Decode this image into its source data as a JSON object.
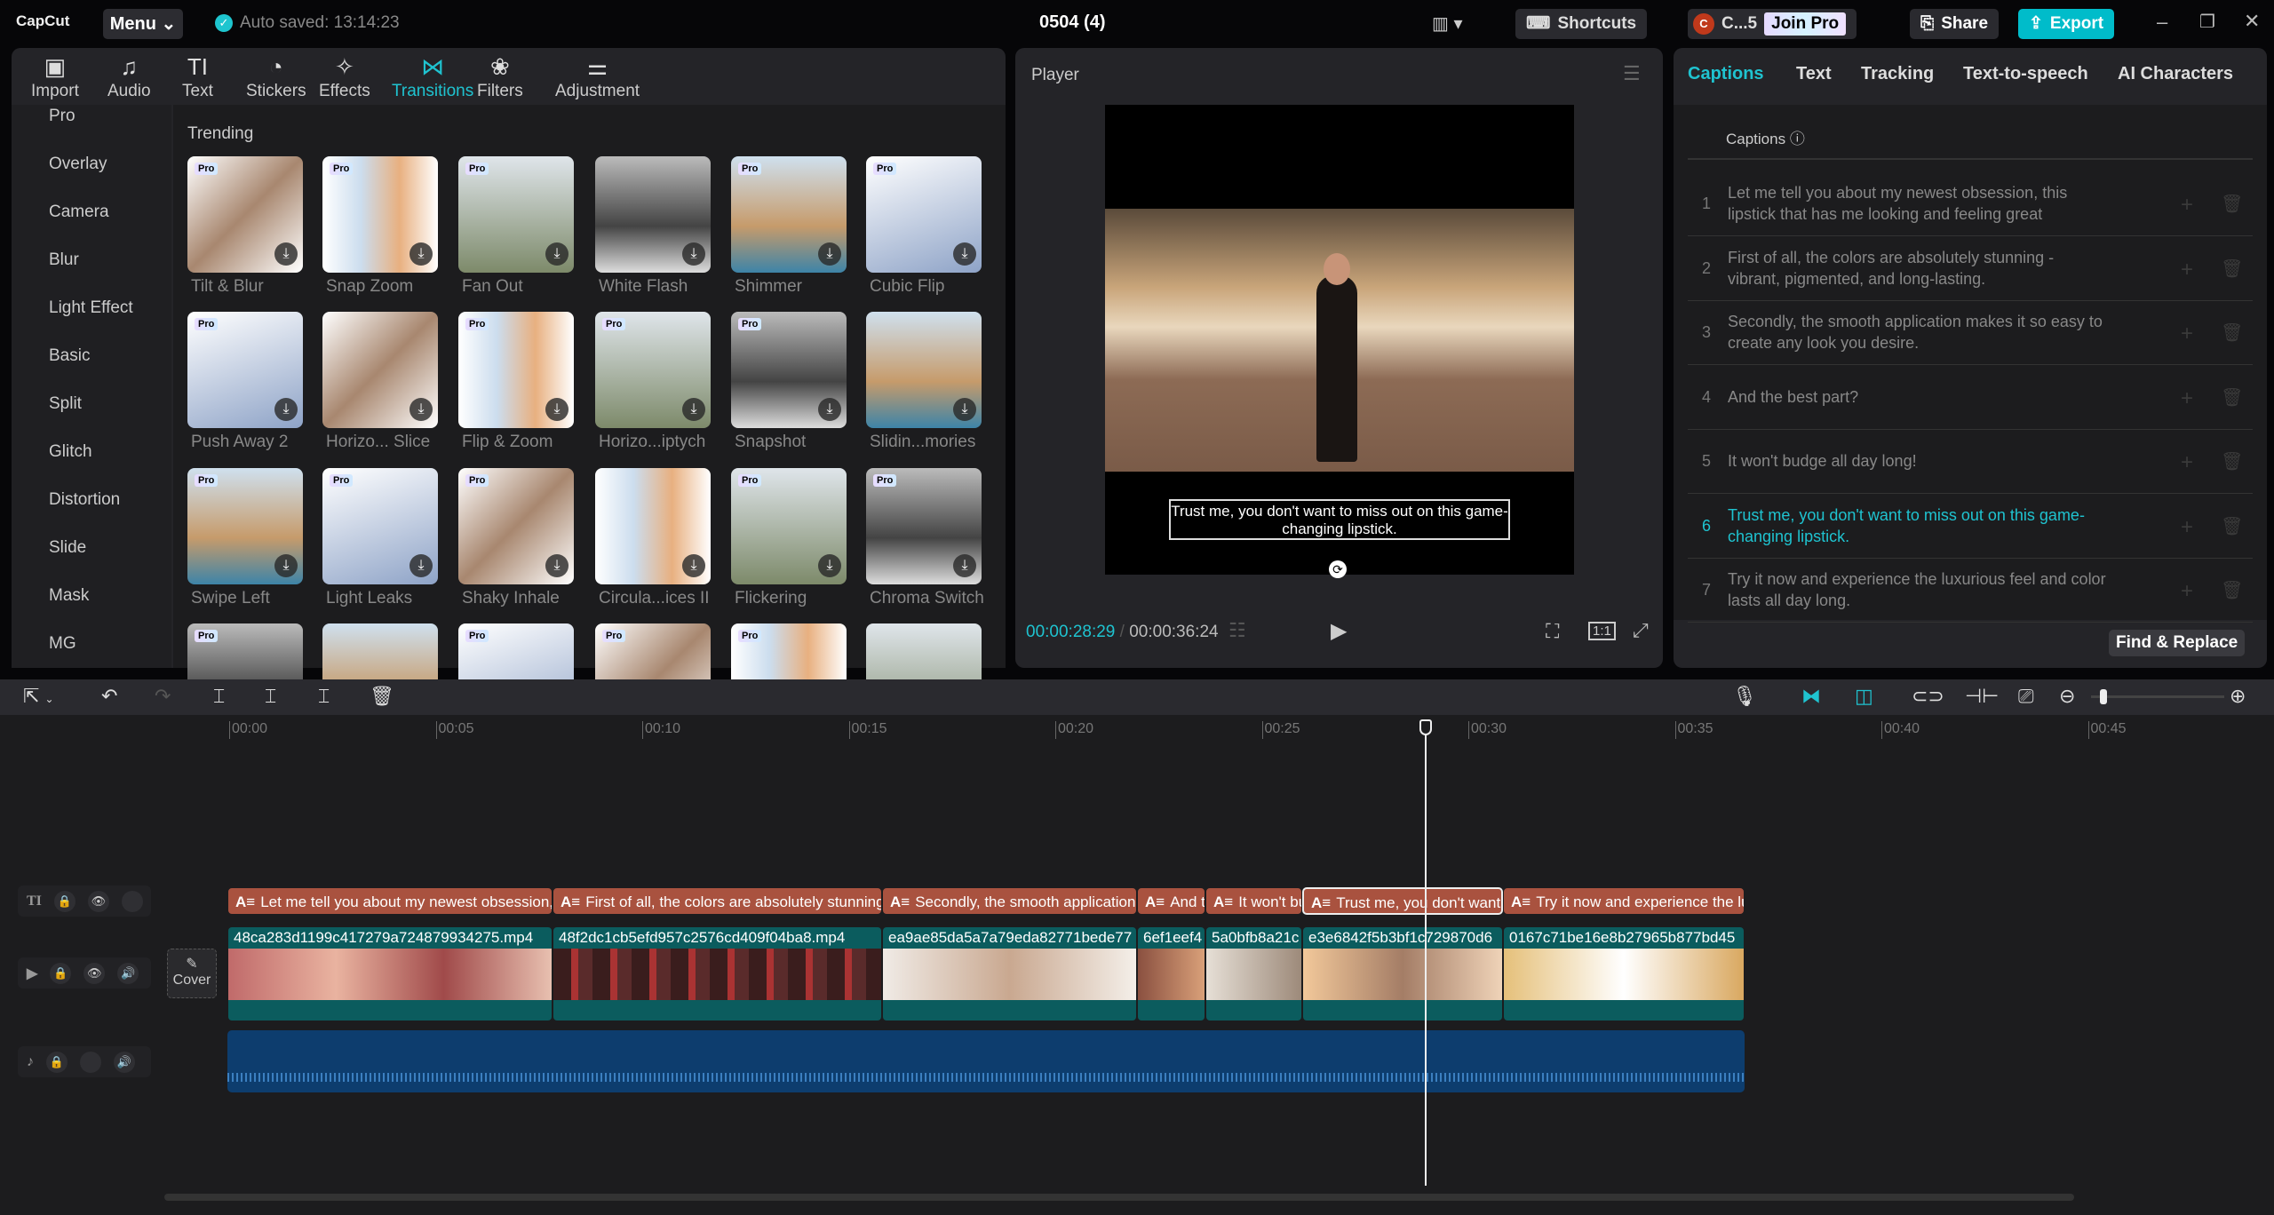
{
  "app": {
    "logo": "CapCut",
    "menu": "Menu",
    "autosave": "Auto saved: 13:14:23",
    "project_title": "0504 (4)",
    "shortcuts": "Shortcuts",
    "user": "C...5",
    "user_initial": "C",
    "join_pro": "Join Pro",
    "share": "Share",
    "export": "Export"
  },
  "toolbar": [
    {
      "label": "Import",
      "icon": "▣"
    },
    {
      "label": "Audio",
      "icon": "♫"
    },
    {
      "label": "Text",
      "icon": "TI"
    },
    {
      "label": "Stickers",
      "icon": "◔"
    },
    {
      "label": "Effects",
      "icon": "✧"
    },
    {
      "label": "Transitions",
      "icon": "⋈"
    },
    {
      "label": "Filters",
      "icon": "❀"
    },
    {
      "label": "Adjustment",
      "icon": "⚌"
    }
  ],
  "sidebar": [
    "Pro",
    "Overlay",
    "Camera",
    "Blur",
    "Light Effect",
    "Basic",
    "Split",
    "Glitch",
    "Distortion",
    "Slide",
    "Mask",
    "MG"
  ],
  "section_title": "Trending",
  "transitions": [
    {
      "name": "Tilt & Blur",
      "pro": true
    },
    {
      "name": "Snap Zoom",
      "pro": true
    },
    {
      "name": "Fan Out",
      "pro": true
    },
    {
      "name": "White Flash",
      "pro": false
    },
    {
      "name": "Shimmer",
      "pro": true
    },
    {
      "name": "Cubic Flip",
      "pro": true
    },
    {
      "name": "Push Away 2",
      "pro": true
    },
    {
      "name": "Horizo... Slice",
      "pro": false
    },
    {
      "name": "Flip & Zoom",
      "pro": true
    },
    {
      "name": "Horizo...iptych",
      "pro": true
    },
    {
      "name": "Snapshot",
      "pro": true
    },
    {
      "name": "Slidin...mories",
      "pro": false
    },
    {
      "name": "Swipe Left",
      "pro": true
    },
    {
      "name": "Light Leaks",
      "pro": true
    },
    {
      "name": "Shaky Inhale",
      "pro": true
    },
    {
      "name": "Circula...ices II",
      "pro": false
    },
    {
      "name": "Flickering",
      "pro": true
    },
    {
      "name": "Chroma Switch",
      "pro": true
    },
    {
      "name": "",
      "pro": true
    },
    {
      "name": "",
      "pro": false
    },
    {
      "name": "",
      "pro": true
    },
    {
      "name": "",
      "pro": true
    },
    {
      "name": "",
      "pro": true
    },
    {
      "name": "",
      "pro": false
    }
  ],
  "pro_badge": "Pro",
  "player": {
    "title": "Player",
    "caption": "Trust me, you don't want to miss out on this game-changing lipstick.",
    "current_time": "00:00:28:29",
    "total_time": "00:00:36:24",
    "ratio": "1:1"
  },
  "captions_panel": {
    "tabs": [
      "Captions",
      "Text",
      "Tracking",
      "Text-to-speech",
      "AI Characters"
    ],
    "active_tab": 0,
    "header": "Captions",
    "find_replace": "Find & Replace",
    "items": [
      {
        "n": "1",
        "text": "Let me tell you about my newest obsession, this lipstick that has me looking and feeling great"
      },
      {
        "n": "2",
        "text": "First of all, the colors are absolutely stunning - vibrant, pigmented, and long-lasting."
      },
      {
        "n": "3",
        "text": "Secondly, the smooth application makes it so easy to create any look you desire."
      },
      {
        "n": "4",
        "text": "And the best part?"
      },
      {
        "n": "5",
        "text": "It won't budge all day long!"
      },
      {
        "n": "6",
        "text": "Trust me, you don't want to miss out on this game-changing lipstick.",
        "active": true
      },
      {
        "n": "7",
        "text": "Try it now and experience the luxurious feel and color lasts all day long."
      }
    ]
  },
  "timeline": {
    "ruler": [
      "00:00",
      "00:05",
      "00:10",
      "00:15",
      "00:20",
      "00:25",
      "00:30",
      "00:35",
      "00:40",
      "00:45"
    ],
    "playhead_seconds": 28.97,
    "cover": "Cover",
    "text_clips": [
      "Let me tell you about my newest obsession, this lipstick",
      "First of all, the colors are absolutely stunning",
      "Secondly, the smooth application makes it so easy",
      "And the best part?",
      "It won't budge all day long!",
      "Trust me, you don't want to miss out",
      "Try it now and experience the luxurious feel"
    ],
    "video_clips": [
      "48ca283d1199c417279a724879934275.mp4",
      "48f2dc1cb5efd957c2576cd409f04ba8.mp4",
      "ea9ae85da5a7a79eda82771bede77",
      "6ef1eef4",
      "5a0bfb8a21c",
      "e3e6842f5b3bf1c729870d6",
      "0167c71be16e8b27965b877bd45"
    ],
    "selected_text_clip": 5
  },
  "colors": {
    "accent": "#1fc3d0",
    "caption_clip": "#a9523f",
    "video_clip": "#0b5c5e",
    "audio_clip": "#0d3d6e"
  }
}
